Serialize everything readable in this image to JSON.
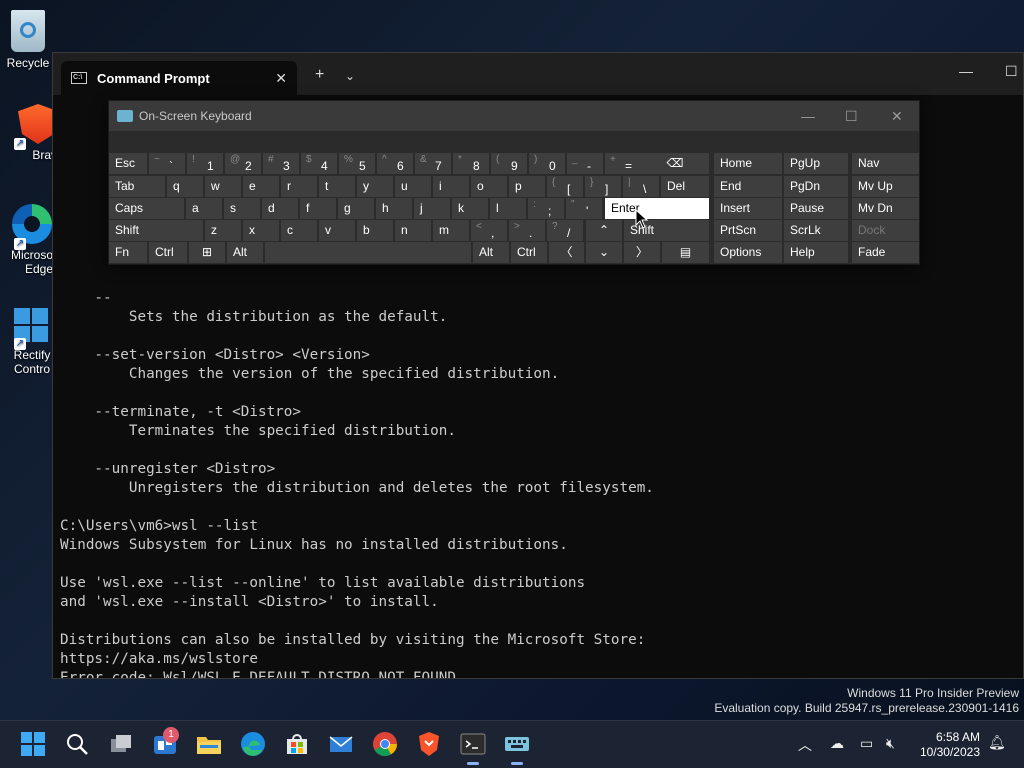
{
  "desktop": {
    "icons": [
      {
        "label": "Recycle",
        "icon": "recycle-bin-icon"
      },
      {
        "label": "Brave",
        "icon": "brave-icon"
      },
      {
        "label1": "Microso",
        "label2": "Edge",
        "icon": "edge-icon"
      },
      {
        "label1": "Rectify",
        "label2": "Contro",
        "icon": "rectify11-icon"
      }
    ]
  },
  "terminal": {
    "tab_title": "Command Prompt",
    "lines": [
      "",
      "",
      "",
      "",
      "",
      "",
      "",
      "    --",
      "        Sets the distribution as the default.",
      "",
      "    --set-version <Distro> <Version>",
      "        Changes the version of the specified distribution.",
      "",
      "    --terminate, -t <Distro>",
      "        Terminates the specified distribution.",
      "",
      "    --unregister <Distro>",
      "        Unregisters the distribution and deletes the root filesystem.",
      "",
      "C:\\Users\\vm6>wsl --list",
      "Windows Subsystem for Linux has no installed distributions.",
      "",
      "Use 'wsl.exe --list --online' to list available distributions",
      "and 'wsl.exe --install <Distro>' to install.",
      "",
      "Distributions can also be installed by visiting the Microsoft Store:",
      "https://aka.ms/wslstore",
      "Error code: Wsl/WSL_E_DEFAULT_DISTRO_NOT_FOUND",
      ""
    ],
    "prompt": "C:\\Users\\vm6>"
  },
  "osk": {
    "title": "On-Screen Keyboard",
    "row1": {
      "esc": "Esc",
      "keys": [
        {
          "sub": "~",
          "main": "`"
        },
        {
          "sub": "!",
          "main": "1"
        },
        {
          "sub": "@",
          "main": "2"
        },
        {
          "sub": "#",
          "main": "3"
        },
        {
          "sub": "$",
          "main": "4"
        },
        {
          "sub": "%",
          "main": "5"
        },
        {
          "sub": "^",
          "main": "6"
        },
        {
          "sub": "&",
          "main": "7"
        },
        {
          "sub": "*",
          "main": "8"
        },
        {
          "sub": "(",
          "main": "9"
        },
        {
          "sub": ")",
          "main": "0"
        },
        {
          "sub": "_",
          "main": "-"
        },
        {
          "sub": "+",
          "main": "="
        }
      ],
      "backspace": "⌫"
    },
    "row2": {
      "tab": "Tab",
      "letters": [
        "q",
        "w",
        "e",
        "r",
        "t",
        "y",
        "u",
        "i",
        "o",
        "p"
      ],
      "brackets": [
        {
          "sub": "{",
          "main": "["
        },
        {
          "sub": "}",
          "main": "]"
        },
        {
          "sub": "|",
          "main": "\\"
        }
      ],
      "del": "Del"
    },
    "row3": {
      "caps": "Caps",
      "letters": [
        "a",
        "s",
        "d",
        "f",
        "g",
        "h",
        "j",
        "k",
        "l"
      ],
      "punct": [
        {
          "sub": ":",
          "main": ";"
        },
        {
          "sub": "\"",
          "main": "'"
        }
      ],
      "enter": "Enter"
    },
    "row4": {
      "shift": "Shift",
      "letters": [
        "z",
        "x",
        "c",
        "v",
        "b",
        "n",
        "m"
      ],
      "punct": [
        {
          "sub": "<",
          "main": ","
        },
        {
          "sub": ">",
          "main": "."
        },
        {
          "sub": "?",
          "main": "/"
        }
      ],
      "up": "⌃",
      "shift_right": "Shift"
    },
    "row5": {
      "fn": "Fn",
      "ctrl": "Ctrl",
      "win": "⊞",
      "alt": "Alt",
      "alt_right": "Alt",
      "ctrl_right": "Ctrl",
      "left": "〈",
      "down": "⌄",
      "right": "〉",
      "menu": "▤"
    },
    "nav": {
      "home": "Home",
      "pgup": "PgUp",
      "nav": "Nav",
      "end": "End",
      "pgdn": "PgDn",
      "mvup": "Mv Up",
      "insert": "Insert",
      "pause": "Pause",
      "mvdn": "Mv Dn",
      "prtscn": "PrtScn",
      "scrlk": "ScrLk",
      "dock": "Dock",
      "options": "Options",
      "help": "Help",
      "fade": "Fade"
    }
  },
  "watermark": {
    "line1": "Windows 11 Pro Insider Preview",
    "line2": "Evaluation copy. Build 25947.rs_prerelease.230901-1416"
  },
  "taskbar": {
    "widgets_badge": "1",
    "time": "6:58 AM",
    "date": "10/30/2023"
  },
  "colors": {
    "terminal_bg": "#0c0c0c",
    "terminal_text": "#cccccc",
    "osk_key": "#3e3e3e",
    "taskbar_bg": "#1c2433"
  }
}
